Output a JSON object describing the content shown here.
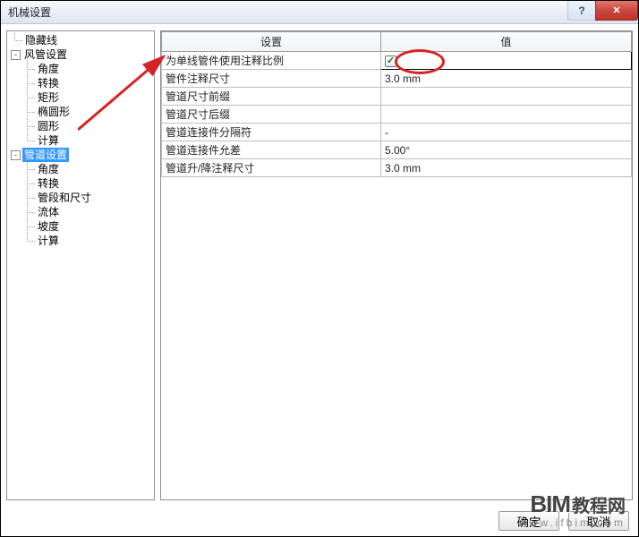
{
  "window": {
    "title": "机械设置"
  },
  "title_buttons": {
    "help": "?",
    "close": "✕"
  },
  "tree": {
    "root0": "隐藏线",
    "root1": "风管设置",
    "r1_children": [
      "角度",
      "转换",
      "矩形",
      "椭圆形",
      "圆形",
      "计算"
    ],
    "root2": "管道设置",
    "r2_children": [
      "角度",
      "转换",
      "管段和尺寸",
      "流体",
      "坡度",
      "计算"
    ]
  },
  "expand": {
    "plus": "+",
    "minus": "-"
  },
  "grid": {
    "headers": {
      "setting": "设置",
      "value": "值"
    },
    "rows": [
      {
        "setting": "为单线管件使用注释比例",
        "value_type": "checkbox",
        "value": true
      },
      {
        "setting": "管件注释尺寸",
        "value_type": "text",
        "value": "3.0 mm"
      },
      {
        "setting": "管道尺寸前缀",
        "value_type": "text",
        "value": ""
      },
      {
        "setting": "管道尺寸后缀",
        "value_type": "text",
        "value": ""
      },
      {
        "setting": "管道连接件分隔符",
        "value_type": "text",
        "value": "-"
      },
      {
        "setting": "管道连接件允差",
        "value_type": "text",
        "value": "5.00°"
      },
      {
        "setting": "管道升/降注释尺寸",
        "value_type": "text",
        "value": "3.0 mm"
      }
    ]
  },
  "buttons": {
    "ok": "确定",
    "cancel": "取消"
  },
  "watermark": {
    "big": "BIM",
    "cn": "教程网",
    "url": "www.ifbim.com"
  },
  "chart_data": null
}
